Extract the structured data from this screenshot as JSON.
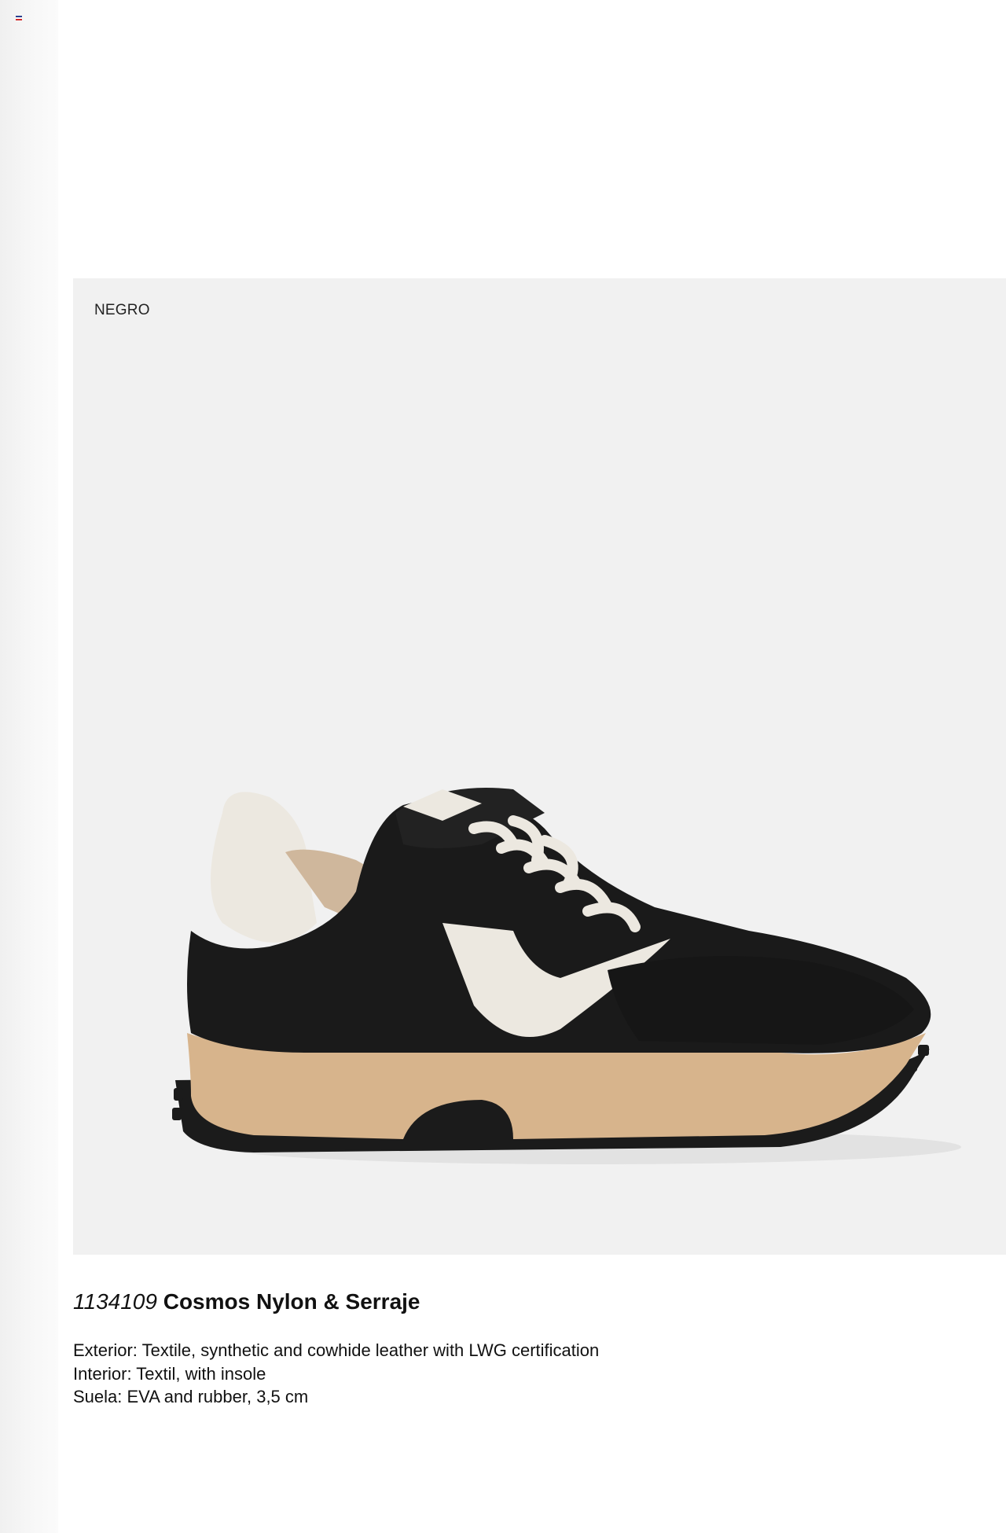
{
  "page": {
    "flag_icon": "flag-icon",
    "flag_colors": [
      "#2a3f8f",
      "#ffffff",
      "#d42a2a"
    ]
  },
  "product": {
    "color_name": "NEGRO",
    "code": "1134109",
    "name": "Cosmos Nylon & Serraje",
    "specs": [
      "Exterior: Textile, synthetic and cowhide leather with LWG certification",
      "Interior: Textil, with insole",
      "Suela: EVA and rubber, 3,5 cm"
    ],
    "image": "black-sneaker-photo",
    "colors": {
      "upper": "#1a1a1a",
      "accent": "#ece8e0",
      "sole": "#d7b48c",
      "panel": "#f1f1f1"
    }
  }
}
